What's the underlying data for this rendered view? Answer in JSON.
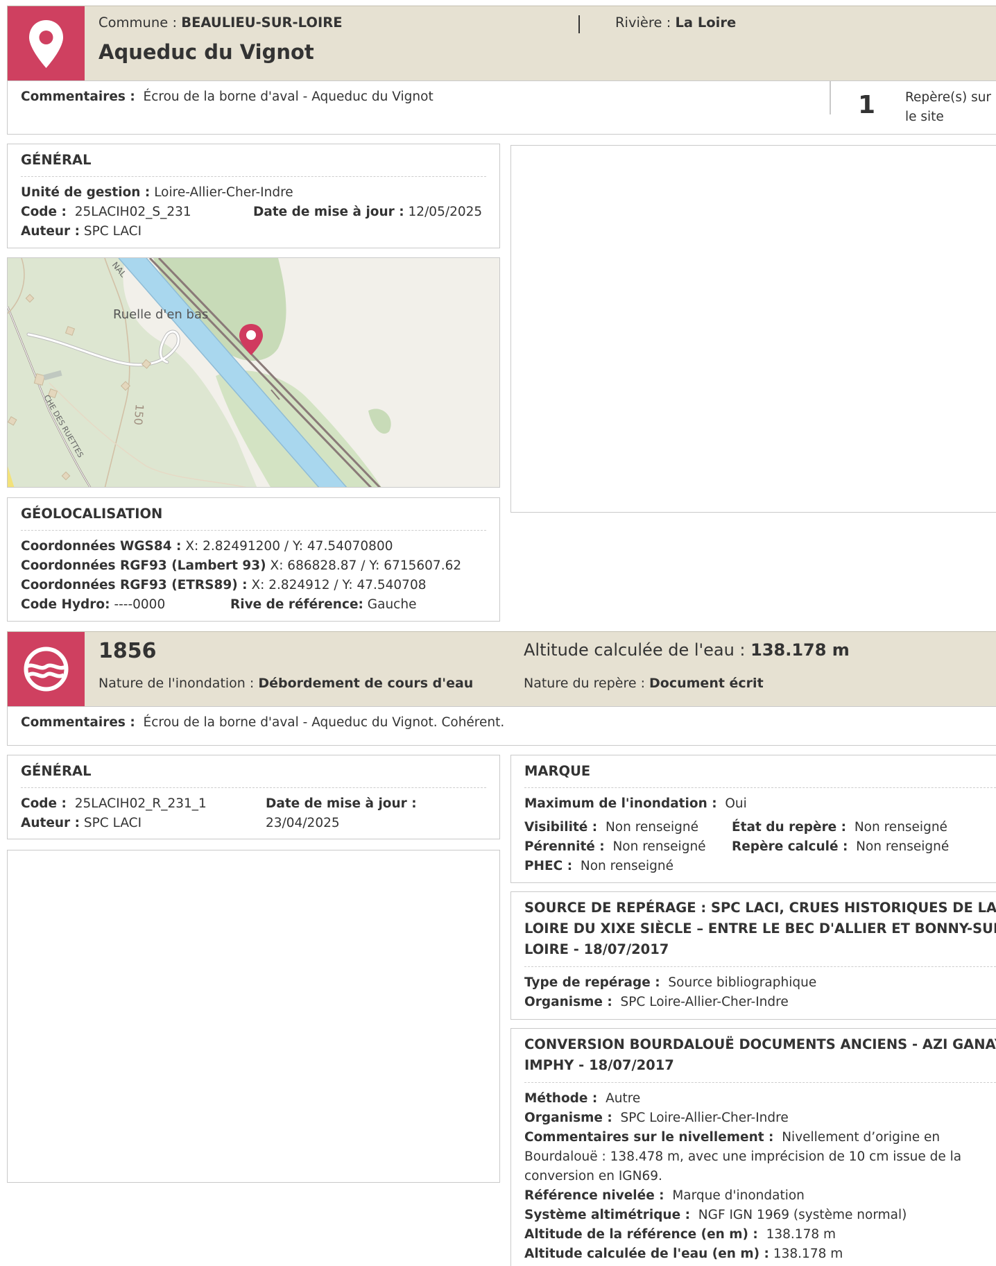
{
  "site": {
    "commune_label": "Commune : ",
    "commune": "BEAULIEU-SUR-LOIRE",
    "riviere_label": "Rivière : ",
    "riviere": "La Loire",
    "name": "Aqueduc du Vignot",
    "comment_label": "Commentaires :",
    "comment": "Écrou de la borne d'aval - Aqueduc du Vignot",
    "repere_count": "1",
    "repere_label_1": "Repère(s) sur",
    "repere_label_2": "le site",
    "icon": "map-pin-icon",
    "accent_color": "#cf4060"
  },
  "site_general": {
    "title": "GÉNÉRAL",
    "unite_label": "Unité de gestion :",
    "unite": "Loire-Allier-Cher-Indre",
    "code_label": "Code :",
    "code": "25LACIH02_S_231",
    "date_label": "Date de mise à jour :",
    "date": "12/05/2025",
    "auteur_label": "Auteur :",
    "auteur": "SPC LACI"
  },
  "map": {
    "labels": {
      "ruelle": "Ruelle d'en bas",
      "nal": "NAL",
      "road": "150",
      "chemin": "CHE DES RUETTES"
    },
    "marker_icon": "map-pin-icon"
  },
  "geoloc": {
    "title": "GÉOLOCALISATION",
    "wgs_label": "Coordonnées WGS84 :",
    "wgs": "X: 2.82491200 / Y: 47.54070800",
    "rgf_lambert_label": "Coordonnées RGF93 (Lambert 93)",
    "rgf_lambert": "X: 686828.87 / Y: 6715607.62",
    "rgf_etrs_label": "Coordonnées RGF93 (ETRS89) :",
    "rgf_etrs": "X: 2.824912 / Y: 47.540708",
    "hydro_label": "Code Hydro:",
    "hydro": "----0000",
    "rive_label": "Rive de référence:",
    "rive": "Gauche"
  },
  "repere": {
    "year": "1856",
    "altitude_label": "Altitude calculée de l'eau : ",
    "altitude": "138.178 m",
    "nature_inond_label": "Nature de l'inondation : ",
    "nature_inond": "Débordement de cours d'eau",
    "nature_repere_label": "Nature du repère : ",
    "nature_repere": "Document écrit",
    "comment_label": "Commentaires :",
    "comment": "Écrou de la borne d'aval - Aqueduc du Vignot. Cohérent.",
    "icon": "water-wave-icon"
  },
  "repere_general": {
    "title": "GÉNÉRAL",
    "code_label": "Code :",
    "code": "25LACIH02_R_231_1",
    "date_label": "Date de mise à jour :",
    "date": "23/04/2025",
    "auteur_label": "Auteur :",
    "auteur": "SPC LACI"
  },
  "marque": {
    "title": "MARQUE",
    "max_label": "Maximum de l'inondation :",
    "max": "Oui",
    "visibilite_label": "Visibilité :",
    "visibilite": "Non renseigné",
    "etat_label": "État du repère :",
    "etat": "Non renseigné",
    "perennite_label": "Pérennité :",
    "perennite": "Non renseigné",
    "calcule_label": "Repère calculé :",
    "calcule": "Non renseigné",
    "phec_label": "PHEC :",
    "phec": "Non renseigné"
  },
  "source": {
    "title_1": "SOURCE DE REPÉRAGE : SPC LACI, CRUES HISTORIQUES DE LA",
    "title_2": "LOIRE DU XIXE SIÈCLE – ENTRE LE BEC D'ALLIER ET BONNY-SUR-",
    "title_3": "LOIRE - 18/07/2017",
    "type_label": "Type de repérage :",
    "type": "Source bibliographique",
    "org_label": "Organisme :",
    "org": "SPC Loire-Allier-Cher-Indre"
  },
  "conversion": {
    "title_1": "CONVERSION BOURDALOUË DOCUMENTS ANCIENS - AZI GANAY-",
    "title_2": "IMPHY - 18/07/2017",
    "methode_label": "Méthode :",
    "methode": "Autre",
    "org_label": "Organisme :",
    "org": "SPC Loire-Allier-Cher-Indre",
    "niv_comment_label": "Commentaires sur le nivellement :",
    "niv_comment_1": "Nivellement d’origine en",
    "niv_comment_2": "Bourdalouë : 138.478 m, avec une imprécision de 10 cm issue de la",
    "niv_comment_3": "conversion en IGN69.",
    "ref_label": "Référence nivelée :",
    "ref": "Marque d'inondation",
    "systeme_label": "Système altimétrique :",
    "systeme": "NGF IGN 1969 (système normal)",
    "alt_ref_label": "Altitude de la référence (en m) :",
    "alt_ref": "138.178 m",
    "alt_eau_label": "Altitude calculée de l'eau (en m) :",
    "alt_eau": "138.178 m"
  }
}
